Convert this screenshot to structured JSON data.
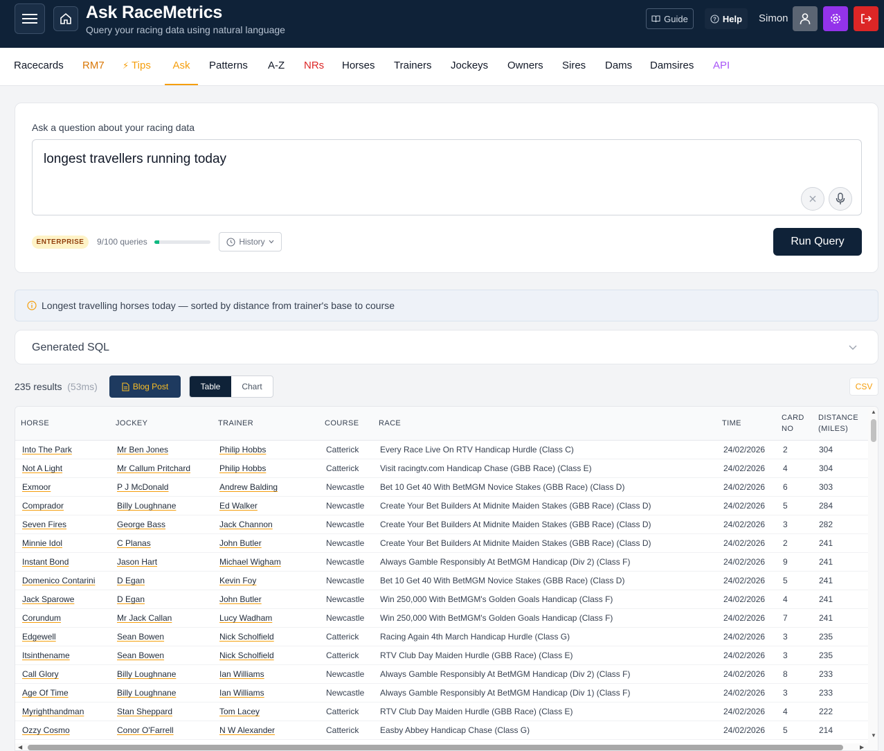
{
  "header": {
    "title": "Ask RaceMetrics",
    "subtitle": "Query your racing data using natural language",
    "guide_label": "Guide",
    "help_label": "Help",
    "user_name": "Simon"
  },
  "nav": {
    "items": [
      {
        "label": "Racecards",
        "color": "#111827"
      },
      {
        "label": "RM7",
        "color": "#d97706"
      },
      {
        "label": "Tips",
        "color": "#f59e0b"
      },
      {
        "label": "Ask",
        "color": "#f59e0b",
        "active": true
      },
      {
        "label": "Patterns",
        "color": "#111827"
      },
      {
        "label": "A-Z",
        "color": "#111827"
      },
      {
        "label": "NRs",
        "color": "#dc2626"
      },
      {
        "label": "Horses",
        "color": "#111827"
      },
      {
        "label": "Trainers",
        "color": "#111827"
      },
      {
        "label": "Jockeys",
        "color": "#111827"
      },
      {
        "label": "Owners",
        "color": "#111827"
      },
      {
        "label": "Sires",
        "color": "#111827"
      },
      {
        "label": "Dams",
        "color": "#111827"
      },
      {
        "label": "Damsires",
        "color": "#111827"
      },
      {
        "label": "API",
        "color": "#a855f7"
      }
    ]
  },
  "query": {
    "label": "Ask a question about your racing data",
    "value": "longest travellers running today",
    "plan": "ENTERPRISE",
    "quota_text": "9/100 queries",
    "quota_fraction": 0.09,
    "history_label": "History",
    "run_label": "Run Query"
  },
  "info": {
    "text": "Longest travelling horses today — sorted by distance from trainer's base to course"
  },
  "sql": {
    "title": "Generated SQL"
  },
  "results": {
    "count": "235 results",
    "time": "(53ms)",
    "blog_label": "Blog Post",
    "table_label": "Table",
    "chart_label": "Chart",
    "csv_label": "CSV"
  },
  "table": {
    "headers": [
      "HORSE",
      "JOCKEY",
      "TRAINER",
      "COURSE",
      "RACE",
      "TIME",
      "CARD\nNO",
      "DISTANCE\n(MILES)"
    ],
    "rows": [
      [
        "Into The Park",
        "Mr Ben Jones",
        "Philip Hobbs",
        "Catterick",
        "Every Race Live On RTV Handicap Hurdle (Class C)",
        "24/02/2026",
        "2",
        "304"
      ],
      [
        "Not A Light",
        "Mr Callum Pritchard",
        "Philip Hobbs",
        "Catterick",
        "Visit racingtv.com Handicap Chase (GBB Race) (Class E)",
        "24/02/2026",
        "4",
        "304"
      ],
      [
        "Exmoor",
        "P J McDonald",
        "Andrew Balding",
        "Newcastle",
        "Bet 10 Get 40 With BetMGM Novice Stakes (GBB Race) (Class D)",
        "24/02/2026",
        "6",
        "303"
      ],
      [
        "Comprador",
        "Billy Loughnane",
        "Ed Walker",
        "Newcastle",
        "Create Your Bet Builders At Midnite Maiden Stakes (GBB Race) (Class D)",
        "24/02/2026",
        "5",
        "284"
      ],
      [
        "Seven Fires",
        "George Bass",
        "Jack Channon",
        "Newcastle",
        "Create Your Bet Builders At Midnite Maiden Stakes (GBB Race) (Class D)",
        "24/02/2026",
        "3",
        "282"
      ],
      [
        "Minnie Idol",
        "C Planas",
        "John Butler",
        "Newcastle",
        "Create Your Bet Builders At Midnite Maiden Stakes (GBB Race) (Class D)",
        "24/02/2026",
        "2",
        "241"
      ],
      [
        "Instant Bond",
        "Jason Hart",
        "Michael Wigham",
        "Newcastle",
        "Always Gamble Responsibly At BetMGM Handicap (Div 2) (Class F)",
        "24/02/2026",
        "9",
        "241"
      ],
      [
        "Domenico Contarini",
        "D Egan",
        "Kevin Foy",
        "Newcastle",
        "Bet 10 Get 40 With BetMGM Novice Stakes (GBB Race) (Class D)",
        "24/02/2026",
        "5",
        "241"
      ],
      [
        "Jack Sparowe",
        "D Egan",
        "John Butler",
        "Newcastle",
        "Win 250,000 With BetMGM's Golden Goals Handicap (Class F)",
        "24/02/2026",
        "4",
        "241"
      ],
      [
        "Corundum",
        "Mr Jack Callan",
        "Lucy Wadham",
        "Newcastle",
        "Win 250,000 With BetMGM's Golden Goals Handicap (Class F)",
        "24/02/2026",
        "7",
        "241"
      ],
      [
        "Edgewell",
        "Sean Bowen",
        "Nick Scholfield",
        "Catterick",
        "Racing Again 4th March Handicap Hurdle (Class G)",
        "24/02/2026",
        "3",
        "235"
      ],
      [
        "Itsinthename",
        "Sean Bowen",
        "Nick Scholfield",
        "Catterick",
        "RTV Club Day Maiden Hurdle (GBB Race) (Class E)",
        "24/02/2026",
        "3",
        "235"
      ],
      [
        "Call Glory",
        "Billy Loughnane",
        "Ian Williams",
        "Newcastle",
        "Always Gamble Responsibly At BetMGM Handicap (Div 2) (Class F)",
        "24/02/2026",
        "8",
        "233"
      ],
      [
        "Age Of Time",
        "Billy Loughnane",
        "Ian Williams",
        "Newcastle",
        "Always Gamble Responsibly At BetMGM Handicap (Div 1) (Class F)",
        "24/02/2026",
        "3",
        "233"
      ],
      [
        "Myrighthandman",
        "Stan Sheppard",
        "Tom Lacey",
        "Catterick",
        "RTV Club Day Maiden Hurdle (GBB Race) (Class E)",
        "24/02/2026",
        "4",
        "222"
      ],
      [
        "Ozzy Cosmo",
        "Conor O'Farrell",
        "N W Alexander",
        "Catterick",
        "Easby Abbey Handicap Chase (Class G)",
        "24/02/2026",
        "5",
        "214"
      ]
    ]
  }
}
